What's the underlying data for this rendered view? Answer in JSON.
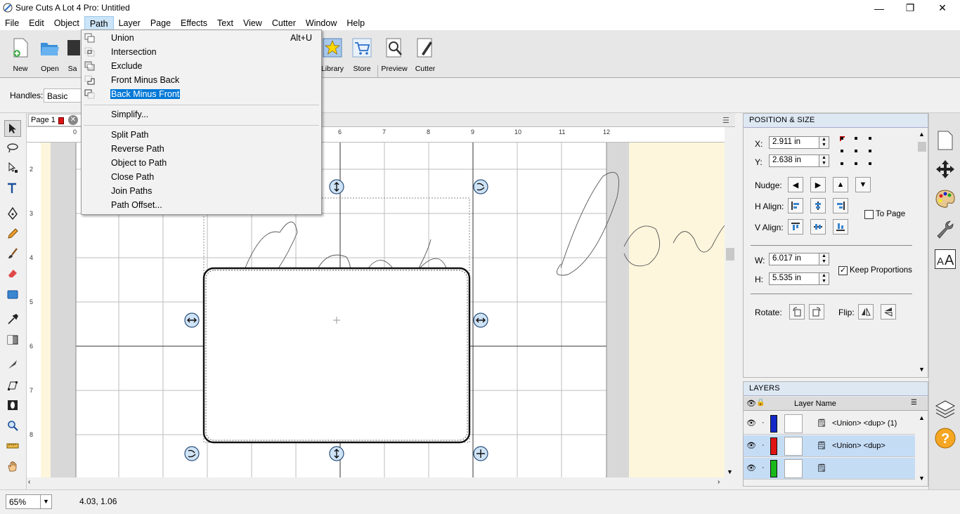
{
  "window": {
    "title": "Sure Cuts A Lot 4 Pro: Untitled",
    "minimize": "—",
    "maximize": "❐",
    "close": "✕"
  },
  "menubar": [
    "File",
    "Edit",
    "Object",
    "Path",
    "Layer",
    "Page",
    "Effects",
    "Text",
    "View",
    "Cutter",
    "Window",
    "Help"
  ],
  "toolbar": {
    "new": "New",
    "open": "Open",
    "save": "Sa",
    "library": "Library",
    "store": "Store",
    "preview": "Preview",
    "cutter": "Cutter"
  },
  "handles": {
    "label": "Handles:",
    "value": "Basic"
  },
  "page_tab": {
    "label": "Page 1"
  },
  "ruler": {
    "top": [
      "0",
      "6",
      "7",
      "8",
      "9",
      "10",
      "11",
      "12"
    ],
    "left": [
      "2",
      "3",
      "4",
      "5",
      "6",
      "7",
      "8"
    ]
  },
  "path_menu": {
    "items": [
      {
        "label": "Union",
        "shortcut": "Alt+U"
      },
      {
        "label": "Intersection"
      },
      {
        "label": "Exclude"
      },
      {
        "label": "Front Minus Back"
      },
      {
        "label": "Back Minus Front",
        "highlighted": true
      },
      {
        "label": "Simplify..."
      },
      {
        "label": "Split Path"
      },
      {
        "label": "Reverse Path"
      },
      {
        "label": "Object to Path"
      },
      {
        "label": "Close Path"
      },
      {
        "label": "Join Paths"
      },
      {
        "label": "Path Offset..."
      }
    ]
  },
  "position_size": {
    "title": "POSITION & SIZE",
    "x_label": "X:",
    "x_value": "2.911 in",
    "y_label": "Y:",
    "y_value": "2.638 in",
    "nudge_label": "Nudge:",
    "h_align_label": "H Align:",
    "v_align_label": "V Align:",
    "to_page_label": "To Page",
    "w_label": "W:",
    "w_value": "6.017 in",
    "h_label": "H:",
    "h_value": "5.535 in",
    "keep_proportions_label": "Keep Proportions",
    "keep_proportions": true,
    "rotate_label": "Rotate:",
    "flip_label": "Flip:"
  },
  "layers": {
    "title": "LAYERS",
    "column_header": "Layer Name",
    "rows": [
      {
        "name": "<Union> <dup> (1)",
        "color": "#1428c8"
      },
      {
        "name": "<Union> <dup>",
        "color": "#e01414"
      },
      {
        "name": "",
        "color": "#18b818"
      }
    ]
  },
  "status": {
    "zoom": "65%",
    "coords": "4.03, 1.06"
  },
  "colors": {
    "accent": "#0078d7",
    "panel_header": "#dde8f3",
    "canvas_margin": "#fdf6dc"
  }
}
